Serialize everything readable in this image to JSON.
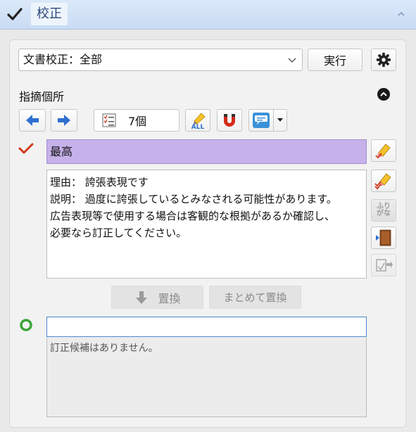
{
  "titlebar": {
    "title": "校正",
    "check_icon": "checkmark-icon",
    "collapse_icon": "chevron-up-icon"
  },
  "toolbar": {
    "mode_select_value": "文書校正：全部",
    "run_label": "実行",
    "settings_icon": "gear-icon"
  },
  "findings": {
    "section_label": "指摘個所",
    "count_label": "7個",
    "prev_icon": "arrow-left-icon",
    "next_icon": "arrow-right-icon",
    "all_icon": "highlight-all-icon",
    "all_text": "ALL",
    "magnet_icon": "magnet-icon",
    "balloon_icon": "comment-balloon-icon"
  },
  "issue": {
    "word": "最高",
    "highlight_color": "#c6b1ea",
    "reason_lines": [
      "理由：  誇張表現です",
      "説明：  過度に誇張しているとみなされる可能性があります。",
      "広告表現等で使用する場合は客観的な根拠があるか確認し、",
      "必要なら訂正してください。"
    ]
  },
  "side_buttons": {
    "furigana_line1": "ふり",
    "furigana_line2": "がな"
  },
  "actions": {
    "replace_label": "置換",
    "replace_all_label": "まとめて置換"
  },
  "correction": {
    "input_value": "",
    "candidates_text": "訂正候補はありません。"
  },
  "colors": {
    "accent_blue": "#2f6fd0",
    "check_red": "#d03a1a",
    "green_ring": "#3aa63a"
  }
}
